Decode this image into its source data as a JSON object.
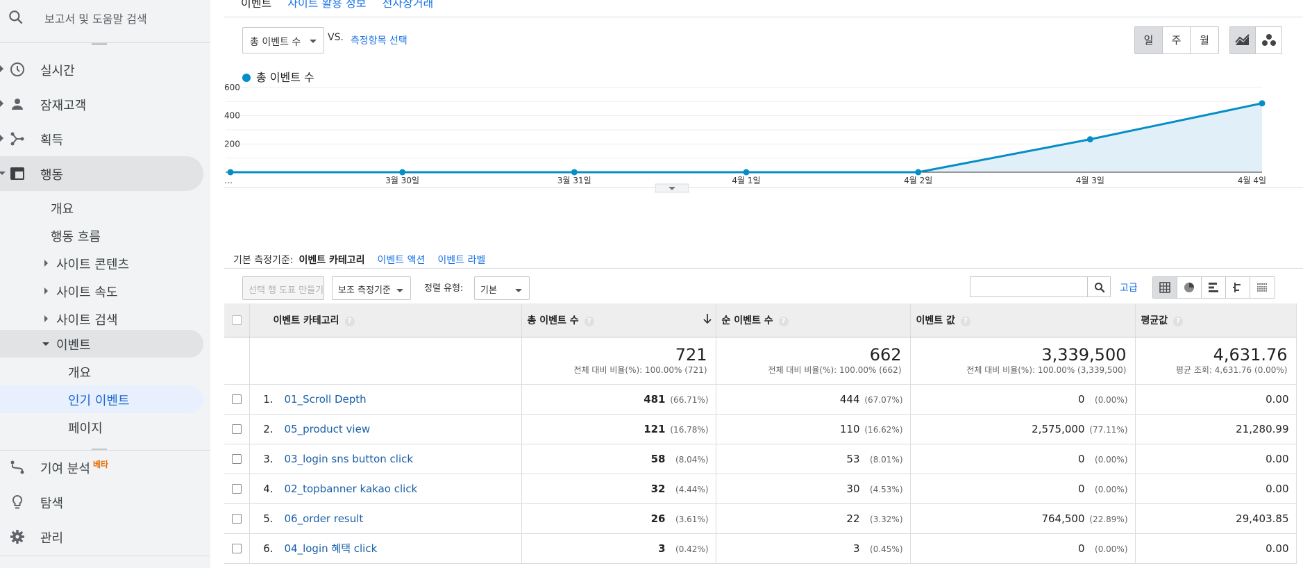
{
  "sidebar": {
    "search_placeholder": "보고서 및 도움말 검색",
    "nav": [
      {
        "label": "실시간",
        "icon": "clock-icon"
      },
      {
        "label": "잠재고객",
        "icon": "person-icon"
      },
      {
        "label": "획득",
        "icon": "acquisition-icon"
      },
      {
        "label": "행동",
        "icon": "behavior-icon"
      }
    ],
    "behavior_sub": {
      "overview": "개요",
      "flow": "행동 흐름",
      "site_content": "사이트 콘텐츠",
      "site_speed": "사이트 속도",
      "site_search": "사이트 검색",
      "events": "이벤트",
      "events_overview": "개요",
      "top_events": "인기 이벤트",
      "pages": "페이지"
    },
    "attribution": {
      "label": "기여 분석",
      "badge": "베타"
    },
    "discover": "탐색",
    "admin": "관리"
  },
  "header": {
    "tabs": [
      "이벤트",
      "사이트 활용 정보",
      "전자상거래"
    ]
  },
  "chart_controls": {
    "metric": "총 이벤트 수",
    "vs": "VS.",
    "compare": "측정항목 선택",
    "periods": [
      "일",
      "주",
      "월"
    ],
    "active_period": "일",
    "legend": "총 이벤트 수"
  },
  "chart_data": {
    "type": "area",
    "categories": [
      "…",
      "3월 30일",
      "3월 31일",
      "4월 1일",
      "4월 2일",
      "4월 3일",
      "4월 4일"
    ],
    "series": [
      {
        "name": "총 이벤트 수",
        "values": [
          0,
          0,
          0,
          0,
          0,
          233,
          488
        ]
      }
    ],
    "y_ticks": [
      "200",
      "400",
      "600"
    ],
    "ylim": [
      0,
      600
    ],
    "color": "#058dc7",
    "fill": "#e1f0f8"
  },
  "dimension_row": {
    "prefix": "기본 측정기준:",
    "active": "이벤트 카테고리",
    "options": [
      "이벤트 액션",
      "이벤트 라벨"
    ]
  },
  "toolbar": {
    "make_chart": "선택 행 도표 만들기",
    "secondary": "보조 측정기준",
    "sort_label": "정렬 유형:",
    "sort_value": "기본",
    "advanced": "고급"
  },
  "table": {
    "headers": [
      "이벤트 카테고리",
      "총 이벤트 수",
      "순 이벤트 수",
      "이벤트 값",
      "평균값"
    ],
    "totals": [
      {
        "value": "721",
        "sub": "전체 대비 비율(%): 100.00% (721)"
      },
      {
        "value": "662",
        "sub": "전체 대비 비율(%): 100.00% (662)"
      },
      {
        "value": "3,339,500",
        "sub": "전체 대비 비율(%): 100.00% (3,339,500)"
      },
      {
        "value": "4,631.76",
        "sub": "평균 조회: 4,631.76 (0.00%)"
      }
    ],
    "rows": [
      {
        "rank": "1.",
        "name": "01_Scroll Depth",
        "total": "481",
        "total_pct": "(66.71%)",
        "unique": "444",
        "unique_pct": "(67.07%)",
        "value": "0",
        "value_pct": "(0.00%)",
        "avg": "0.00"
      },
      {
        "rank": "2.",
        "name": "05_product view",
        "total": "121",
        "total_pct": "(16.78%)",
        "unique": "110",
        "unique_pct": "(16.62%)",
        "value": "2,575,000",
        "value_pct": "(77.11%)",
        "avg": "21,280.99"
      },
      {
        "rank": "3.",
        "name": "03_login sns button click",
        "total": "58",
        "total_pct": "(8.04%)",
        "unique": "53",
        "unique_pct": "(8.01%)",
        "value": "0",
        "value_pct": "(0.00%)",
        "avg": "0.00"
      },
      {
        "rank": "4.",
        "name": "02_topbanner kakao click",
        "total": "32",
        "total_pct": "(4.44%)",
        "unique": "30",
        "unique_pct": "(4.53%)",
        "value": "0",
        "value_pct": "(0.00%)",
        "avg": "0.00"
      },
      {
        "rank": "5.",
        "name": "06_order result",
        "total": "26",
        "total_pct": "(3.61%)",
        "unique": "22",
        "unique_pct": "(3.32%)",
        "value": "764,500",
        "value_pct": "(22.89%)",
        "avg": "29,403.85"
      },
      {
        "rank": "6.",
        "name": "04_login 혜택 click",
        "total": "3",
        "total_pct": "(0.42%)",
        "unique": "3",
        "unique_pct": "(0.45%)",
        "value": "0",
        "value_pct": "(0.00%)",
        "avg": "0.00"
      }
    ]
  }
}
